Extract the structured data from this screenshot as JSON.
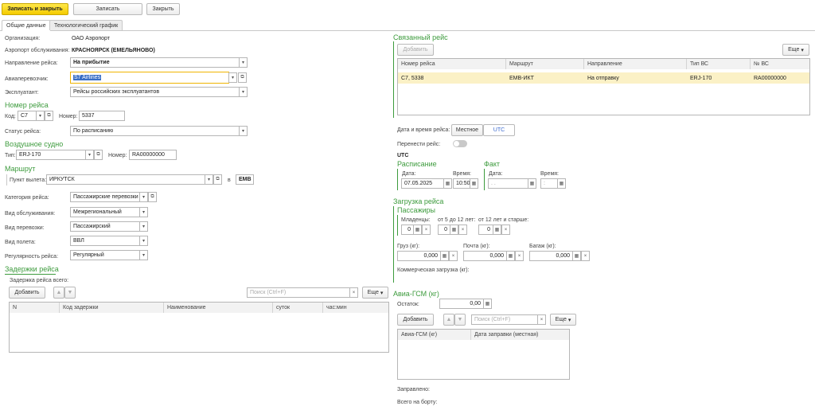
{
  "toolbar": {
    "save_close": "Записать и закрыть",
    "save": "Записать",
    "close": "Закрыть"
  },
  "tabs": [
    "Общие данные",
    "Технологический график"
  ],
  "left": {
    "org_label": "Организация:",
    "org_value": "ОАО Аэропорт",
    "airport_label": "Аэропорт обслуживания:",
    "airport_value": "КРАСНОЯРСК (ЕМЕЛЬЯНОВО)",
    "direction_label": "Направление рейса:",
    "direction_value": "На прибытие",
    "carrier_label": "Авиаперевозчик:",
    "carrier_value": "S7 Airlines",
    "operator_label": "Эксплуатант:",
    "operator_value": "Рейсы российских эксплуатантов",
    "flight_no_header": "Номер рейса",
    "code_label": "Код:",
    "code_value": "C7",
    "number_label": "Номер:",
    "number_value": "5337",
    "status_label": "Статус рейса:",
    "status_value": "По расписанию",
    "aircraft_header": "Воздушное судно",
    "type_label": "Тип:",
    "type_value": "ERJ-170",
    "aircraft_no_label": "Номер:",
    "aircraft_no_value": "RA00000000",
    "route_header": "Маршрут",
    "departure_label": "Пункт вылета:",
    "departure_value": "ИРКУТСК",
    "in_label": "в",
    "in_value": "EMB",
    "category_label": "Категория рейса:",
    "category_value": "Пассажирские перевозки",
    "service_label": "Вид обслуживания:",
    "service_value": "Межрегиональный",
    "transport_label": "Вид перевозки:",
    "transport_value": "Пассажирский",
    "flight_kind_label": "Вид полета:",
    "flight_kind_value": "ВВЛ",
    "regularity_label": "Регулярность рейса:",
    "regularity_value": "Регулярный",
    "delays_header": "Задержки рейса",
    "total_delay_label": "Задержка рейса всего:",
    "add_button": "Добавить",
    "search_placeholder": "Поиск (Ctrl+F)",
    "more_button": "Еще",
    "delay_columns": [
      "N",
      "Код задержки",
      "Наименование",
      "суток",
      "час:мин"
    ]
  },
  "right": {
    "linked_header": "Связанный рейс",
    "add_button": "Добавить",
    "more_button": "Еще",
    "linked_columns": [
      "Номер рейса",
      "Маршрут",
      "Направление",
      "Тип ВС",
      "№ ВС"
    ],
    "linked_rows": [
      [
        "C7, 5338",
        "EMB-ИКТ",
        "На отправку",
        "ERJ-170",
        "RA00000000"
      ]
    ],
    "datetime_label": "Дата и время рейса:",
    "local_button": "Местное",
    "utc_button": "UTC",
    "postpone_label": "Перенести рейс:",
    "utc_caption": "UTC",
    "schedule_header": "Расписание",
    "fact_header": "Факт",
    "date_label": "Дата:",
    "time_label": "Время:",
    "schedule_date": "07.05.2025",
    "schedule_time": "10:50",
    "fact_date": ". .",
    "fact_time": ":",
    "load_header": "Загрузка рейса",
    "passengers_header": "Пассажиры",
    "infants_label": "Младенцы:",
    "age_5_12_label": "от 5 до 12 лет:",
    "age_12_label": "от 12 лет и старше:",
    "infants_value": "0",
    "age_5_12_value": "0",
    "age_12_value": "0",
    "cargo_label": "Груз (кг):",
    "mail_label": "Почта (кг):",
    "baggage_label": "Багаж (кг):",
    "cargo_value": "0,000",
    "mail_value": "0,000",
    "baggage_value": "0,000",
    "commercial_label": "Коммерческая загрузка (кг):",
    "fuel_header": "Авиа-ГСМ (кг)",
    "remainder_label": "Остаток:",
    "remainder_value": "0,00",
    "search_placeholder": "Поиск (Ctrl+F)",
    "fuel_columns": [
      "Авиа-ГСМ (кг)",
      "Дата заправки (местная)"
    ],
    "refueled_label": "Заправлено:",
    "total_board_label": "Всего на борту:"
  }
}
